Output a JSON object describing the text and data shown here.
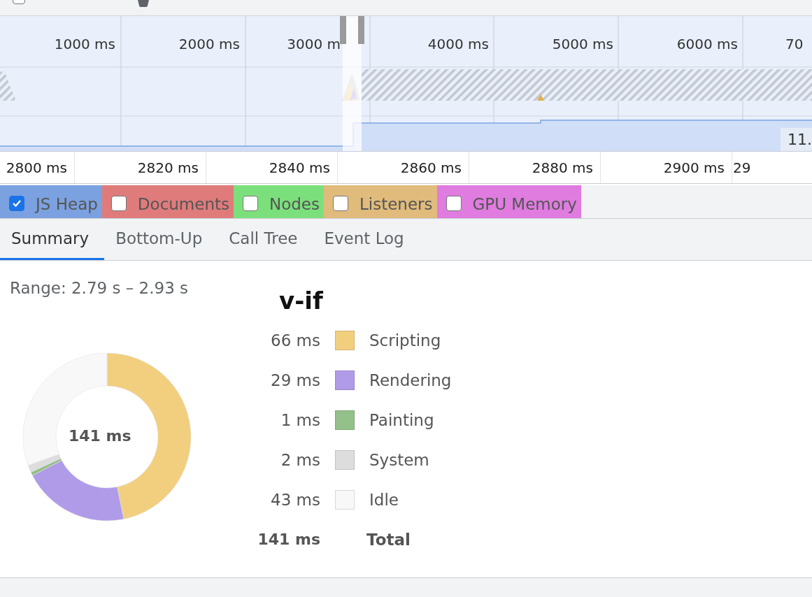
{
  "top_bar": {
    "checkbox": {
      "checked": false
    }
  },
  "overview": {
    "ruler": [
      "1000 ms",
      "2000 ms",
      "3000 m",
      "4000 ms",
      "5000 ms",
      "6000 ms",
      "70"
    ],
    "heap_reading": "11."
  },
  "details_ruler": [
    "2800 ms",
    "2820 ms",
    "2840 ms",
    "2860 ms",
    "2880 ms",
    "2900 ms",
    "29"
  ],
  "counters": [
    {
      "label": "JS Heap",
      "checked": true,
      "color": "#7ba1e0"
    },
    {
      "label": "Documents",
      "checked": false,
      "color": "#e07b7b"
    },
    {
      "label": "Nodes",
      "checked": false,
      "color": "#7be07b"
    },
    {
      "label": "Listeners",
      "checked": false,
      "color": "#e0bb7b"
    },
    {
      "label": "GPU Memory",
      "checked": false,
      "color": "#e07be0"
    }
  ],
  "tabs": [
    {
      "label": "Summary",
      "selected": true
    },
    {
      "label": "Bottom-Up",
      "selected": false
    },
    {
      "label": "Call Tree",
      "selected": false
    },
    {
      "label": "Event Log",
      "selected": false
    }
  ],
  "summary": {
    "range": "Range: 2.79 s – 2.93 s",
    "title": "v-if",
    "center_label": "141 ms",
    "rows": [
      {
        "value": "66 ms",
        "color": "#f2cf7e"
      },
      {
        "value": "29 ms",
        "color": "#af9be8"
      },
      {
        "value": "1 ms",
        "color": "#94c08a"
      },
      {
        "value": "2 ms",
        "color": "#dddddd"
      },
      {
        "value": "43 ms",
        "color": "#f8f8f8"
      }
    ],
    "total": {
      "value": "141 ms",
      "label": "Total"
    },
    "chart_data": {
      "type": "donut",
      "categories": [
        "Scripting",
        "Rendering",
        "Painting",
        "System",
        "Idle"
      ],
      "values": [
        46.8,
        20.6,
        0.7,
        1.4,
        30.5
      ]
    }
  }
}
